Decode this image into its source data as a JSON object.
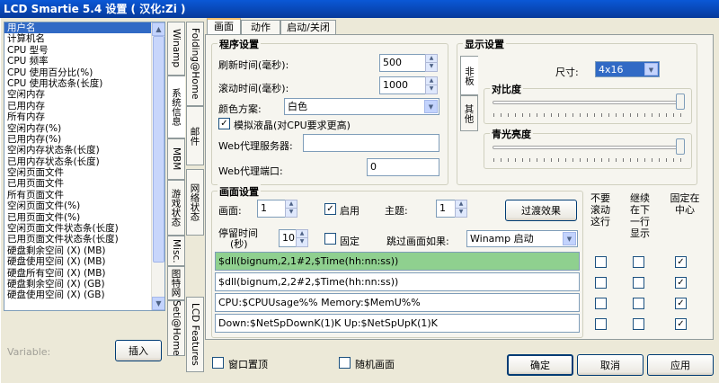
{
  "window": {
    "title": "LCD Smartie 5.4 设置 ( 汉化:Zi )"
  },
  "variables_list": {
    "items": [
      "用户名",
      "计算机名",
      "CPU 型号",
      "CPU 频率",
      "CPU 使用百分比(%)",
      "CPU 使用状态条(长度)",
      "空闲内存",
      "已用内存",
      "所有内存",
      "空闲内存(%)",
      "已用内存(%)",
      "空闲内存状态条(长度)",
      "已用内存状态条(长度)",
      "空闲页面文件",
      "已用页面文件",
      "所有页面文件",
      "空闲页面文件(%)",
      "已用页面文件(%)",
      "空闲页面文件状态条(长度)",
      "已用页面文件状态条(长度)",
      "硬盘剩余空间 (X) (MB)",
      "硬盘使用空间 (X) (MB)",
      "硬盘所有空间 (X) (MB)",
      "硬盘剩余空间 (X) (GB)",
      "硬盘使用空间 (X) (GB)"
    ],
    "selected_index": 0
  },
  "variable_label": "Variable:",
  "insert_button": "插入",
  "side_tabs_left": [
    "Winamp",
    "系统信息",
    "MBM",
    "游戏状态",
    "Misc.",
    "图特网",
    "Seti@Home"
  ],
  "side_tabs_right": [
    "Folding@Home",
    "邮件",
    "网络状态",
    "LCD Features"
  ],
  "top_tabs": [
    "画面",
    "动作",
    "启动/关闭"
  ],
  "program_settings": {
    "title": "程序设置",
    "refresh_label": "刷新时间(毫秒):",
    "refresh_value": "500",
    "scroll_label": "滚动时间(毫秒):",
    "scroll_value": "1000",
    "color_label": "颜色方案:",
    "color_value": "白色",
    "simulate_label": "模拟液晶(对CPU要求更高)",
    "simulate_checked": true,
    "proxy_server_label": "Web代理服务器:",
    "proxy_server_value": "",
    "proxy_port_label": "Web代理端口:",
    "proxy_port_value": "0"
  },
  "display_settings": {
    "title": "显示设置",
    "vtabs": [
      "非板",
      "其他"
    ],
    "size_label": "尺寸:",
    "size_value": "4x16",
    "contrast_label": "对比度",
    "backlight_label": "青光亮度"
  },
  "screen_settings": {
    "title": "画面设置",
    "screen_label": "画面:",
    "screen_value": "1",
    "enable_label": "启用",
    "enable_checked": true,
    "theme_label": "主题:",
    "theme_value": "1",
    "transition_button": "过渡效果",
    "stay_label_1": "停留时间",
    "stay_label_2": "(秒)",
    "stay_value": "10",
    "fixed_label": "固定",
    "fixed_checked": false,
    "skip_label": "跳过画面如果:",
    "skip_value": "Winamp 启动",
    "lines": [
      "$dll(bignum,2,1#2,$Time(hh:nn:ss))",
      "$dll(bignum,2,2#2,$Time(hh:nn:ss))",
      "CPU:$CPUUsage%% Memory:$MemU%%",
      "Down:$NetSpDownK(1)K Up:$NetSpUpK(1)K"
    ],
    "col_no_scroll": [
      "不要",
      "滚动",
      "这行"
    ],
    "col_continue": [
      "继续",
      "在下",
      "一行",
      "显示"
    ],
    "col_center": [
      "固定在",
      "中心"
    ],
    "no_scroll_checked": [
      false,
      false,
      false,
      false
    ],
    "continue_checked": [
      false,
      false,
      false,
      false
    ],
    "center_checked": [
      true,
      true,
      true,
      true
    ]
  },
  "bottom": {
    "topmost_label": "窗口置顶",
    "topmost_checked": false,
    "random_label": "随机画面",
    "random_checked": false,
    "ok_button": "确定",
    "cancel_button": "取消",
    "apply_button": "应用"
  }
}
